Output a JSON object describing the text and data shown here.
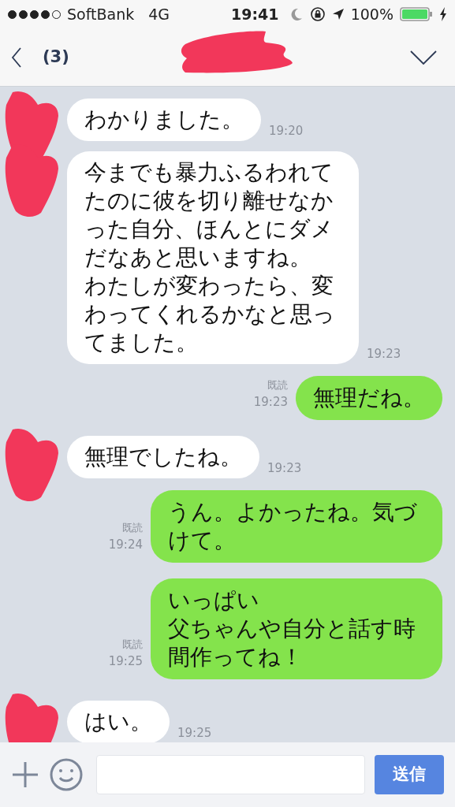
{
  "status_bar": {
    "signal_dots": [
      {
        "on": true
      },
      {
        "on": true
      },
      {
        "on": true
      },
      {
        "on": true
      },
      {
        "on": false
      }
    ],
    "carrier": "SoftBank",
    "network": "4G",
    "time": "19:41",
    "battery_percent": "100%"
  },
  "header": {
    "back_count": "(3)",
    "title_redacted": true
  },
  "messages": [
    {
      "kind": "incoming",
      "text": "わかりました。",
      "time": "19:20",
      "sender_redacted": true
    },
    {
      "kind": "incoming",
      "text": "今までも暴力ふるわれてたのに彼を切り離せなかった自分、ほんとにダメだなあと思いますね。",
      "text_2": "わたしが変わったら、変わってくれるかなと思ってました。",
      "time": "19:23",
      "sender_redacted": true
    },
    {
      "kind": "outgoing",
      "text": "無理だね。",
      "read": "既読",
      "time": "19:23"
    },
    {
      "kind": "incoming",
      "text": "無理でしたね。",
      "time": "19:23",
      "sender_redacted": true
    },
    {
      "kind": "outgoing",
      "text": "うん。よかったね。気づけて。",
      "read": "既読",
      "time": "19:24"
    },
    {
      "kind": "outgoing",
      "text": "いっぱい",
      "text_2": "父ちゃんや自分と話す時間作ってね！",
      "read": "既読",
      "time": "19:25"
    },
    {
      "kind": "incoming",
      "text": "はい。",
      "time": "19:25",
      "sender_redacted": true
    }
  ],
  "composer": {
    "send_label": "送信"
  }
}
